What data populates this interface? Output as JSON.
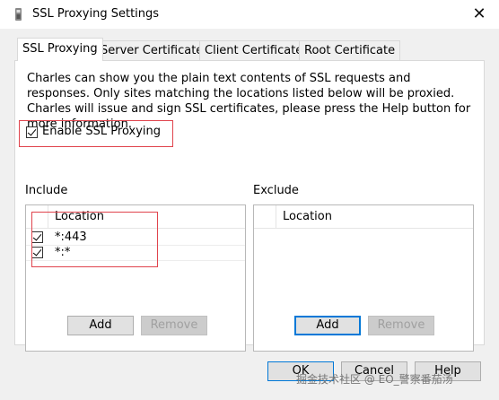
{
  "window": {
    "title": "SSL Proxying Settings",
    "close_glyph": "✕"
  },
  "tabs": [
    {
      "label": "SSL Proxying",
      "active": true
    },
    {
      "label": "Server Certificates",
      "active": false
    },
    {
      "label": "Client Certificates",
      "active": false
    },
    {
      "label": "Root Certificate",
      "active": false
    }
  ],
  "description": "Charles can show you the plain text contents of SSL requests and responses. Only sites matching the locations listed below will be proxied. Charles will issue and sign SSL certificates, please press the Help button for more information.",
  "enable_ssl": {
    "label": "Enable SSL Proxying",
    "checked": true
  },
  "include": {
    "label": "Include",
    "column": "Location",
    "rows": [
      {
        "location": "*:443",
        "checked": true
      },
      {
        "location": "*:*",
        "checked": true
      }
    ],
    "add": "Add",
    "remove": "Remove"
  },
  "exclude": {
    "label": "Exclude",
    "column": "Location",
    "add": "Add",
    "remove": "Remove"
  },
  "footer": {
    "ok": "OK",
    "cancel": "Cancel",
    "help": "Help"
  },
  "watermark": "掘金技术社区 @ EO_警察番茄汤",
  "colors": {
    "highlight": "#e0444d",
    "focus": "#0078d7"
  }
}
